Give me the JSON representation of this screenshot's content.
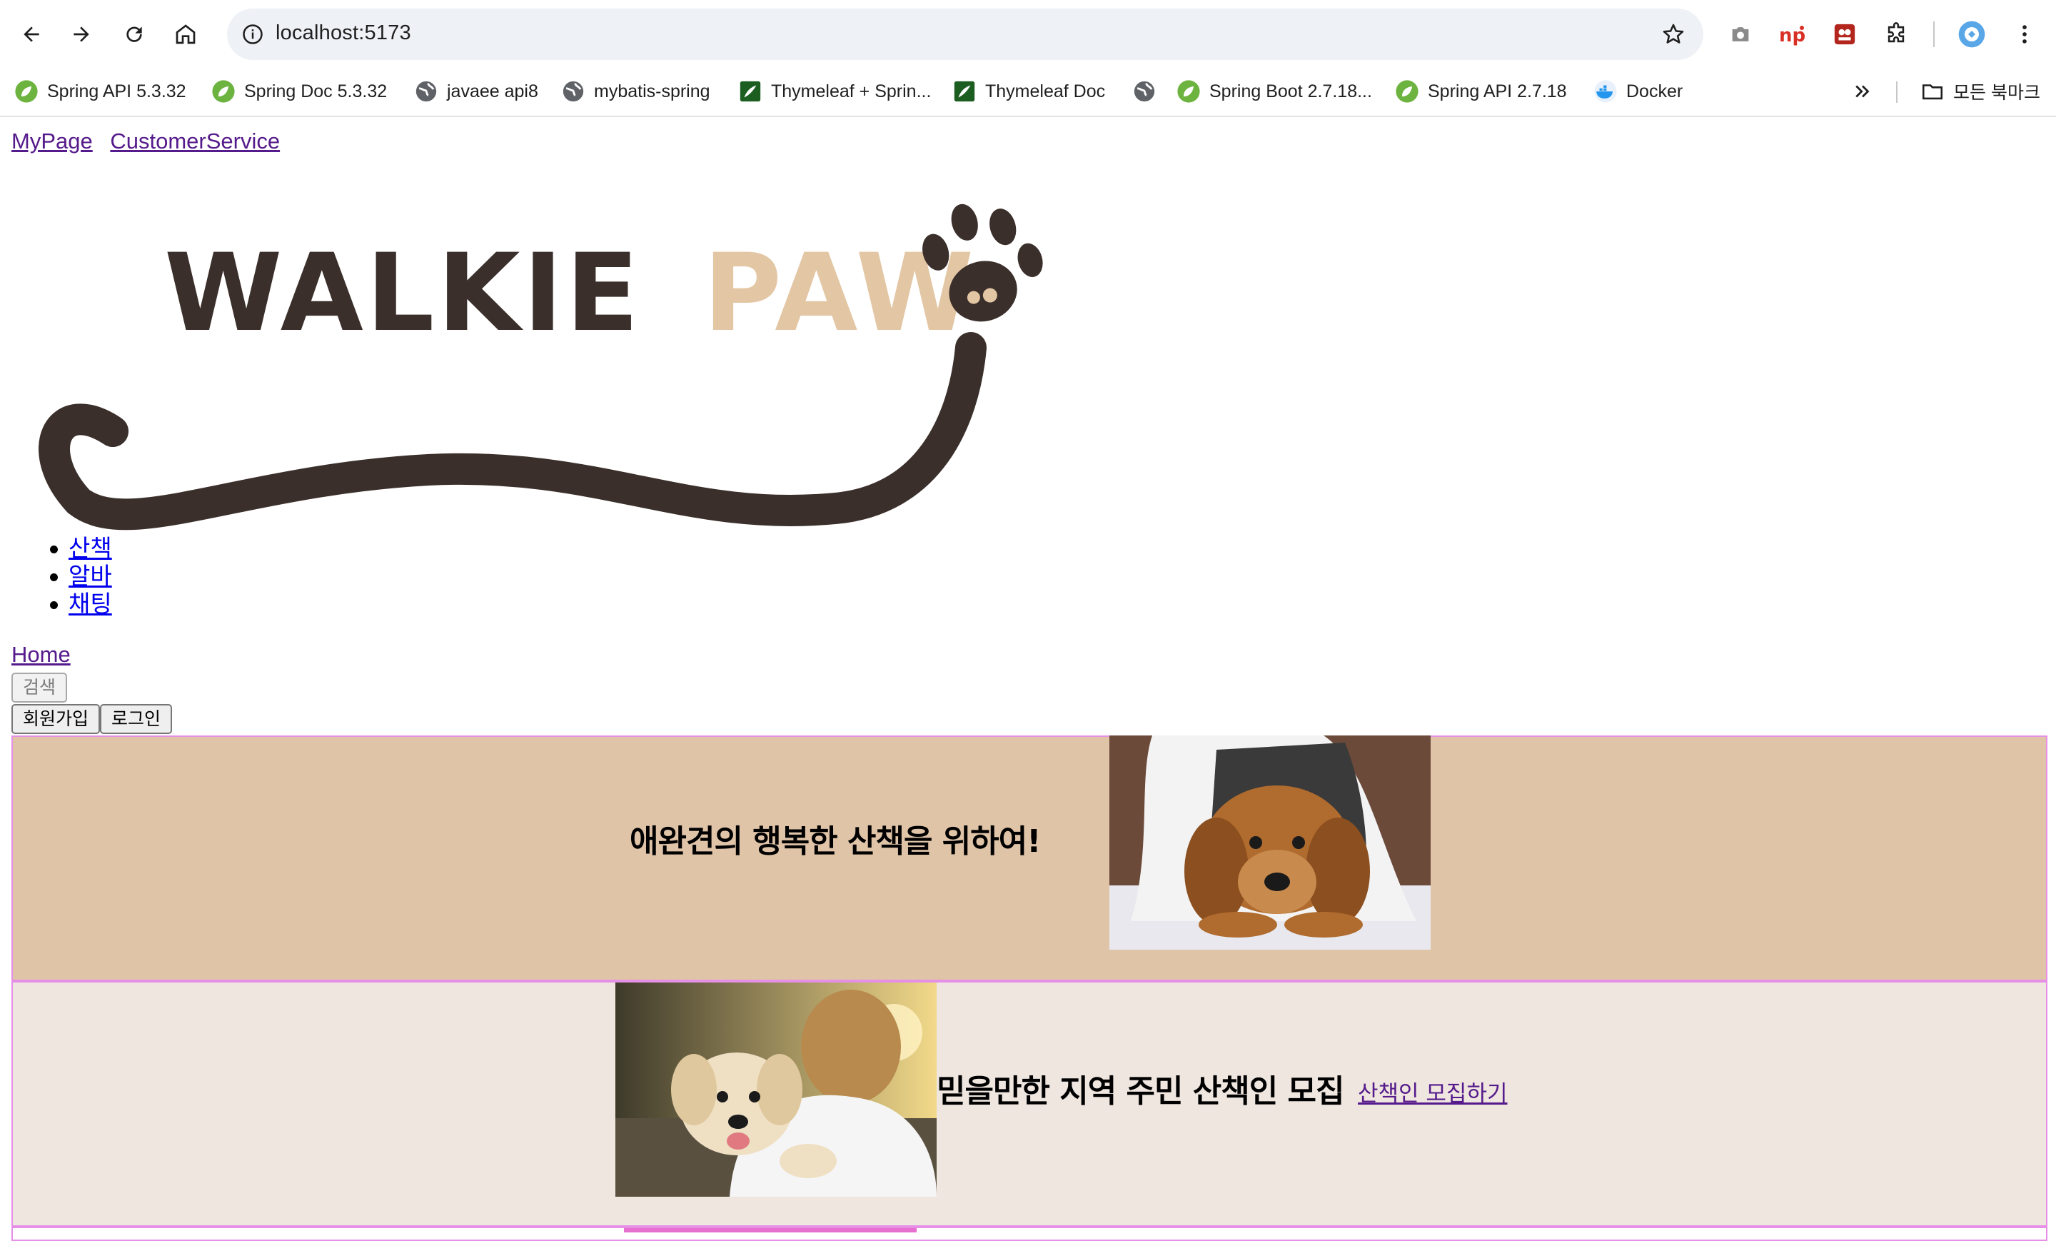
{
  "browser": {
    "url": "localhost:5173",
    "bookmarks": [
      {
        "label": "Spring API 5.3.32",
        "icon": "spring-leaf-icon"
      },
      {
        "label": "Spring Doc 5.3.32",
        "icon": "spring-leaf-icon"
      },
      {
        "label": "javaee api8",
        "icon": "globe-icon"
      },
      {
        "label": "mybatis-spring",
        "icon": "globe-icon"
      },
      {
        "label": "Thymeleaf + Sprin...",
        "icon": "thymeleaf-icon"
      },
      {
        "label": "Thymeleaf Doc",
        "icon": "thymeleaf-icon"
      },
      {
        "label": "",
        "icon": "globe-icon"
      },
      {
        "label": "Spring Boot 2.7.18...",
        "icon": "spring-leaf-icon"
      },
      {
        "label": "Spring API  2.7.18",
        "icon": "spring-leaf-icon"
      },
      {
        "label": "Docker",
        "icon": "docker-icon"
      }
    ],
    "all_bookmarks_label": "모든 북마크"
  },
  "page": {
    "top_links": [
      "MyPage",
      "CustomerService"
    ],
    "logo_text_left": "WALKIE",
    "logo_text_right": "PAW",
    "menu": [
      "산책",
      "알바",
      "채팅"
    ],
    "home_link": "Home",
    "search_button": "검색",
    "signup_button": "회원가입",
    "login_button": "로그인",
    "hero_title": "애완견의 행복한 산책을 위하여!",
    "recruit_title": "믿을만한 지역 주민 산책인 모집",
    "recruit_link": "산책인 모집하기"
  },
  "colors": {
    "band1_bg": "#e0c4a8",
    "band2_bg": "#efe6e0",
    "band_border": "#e58fe7",
    "logo_beige": "#e3c6a4",
    "logo_brown": "#3b2f2b"
  }
}
